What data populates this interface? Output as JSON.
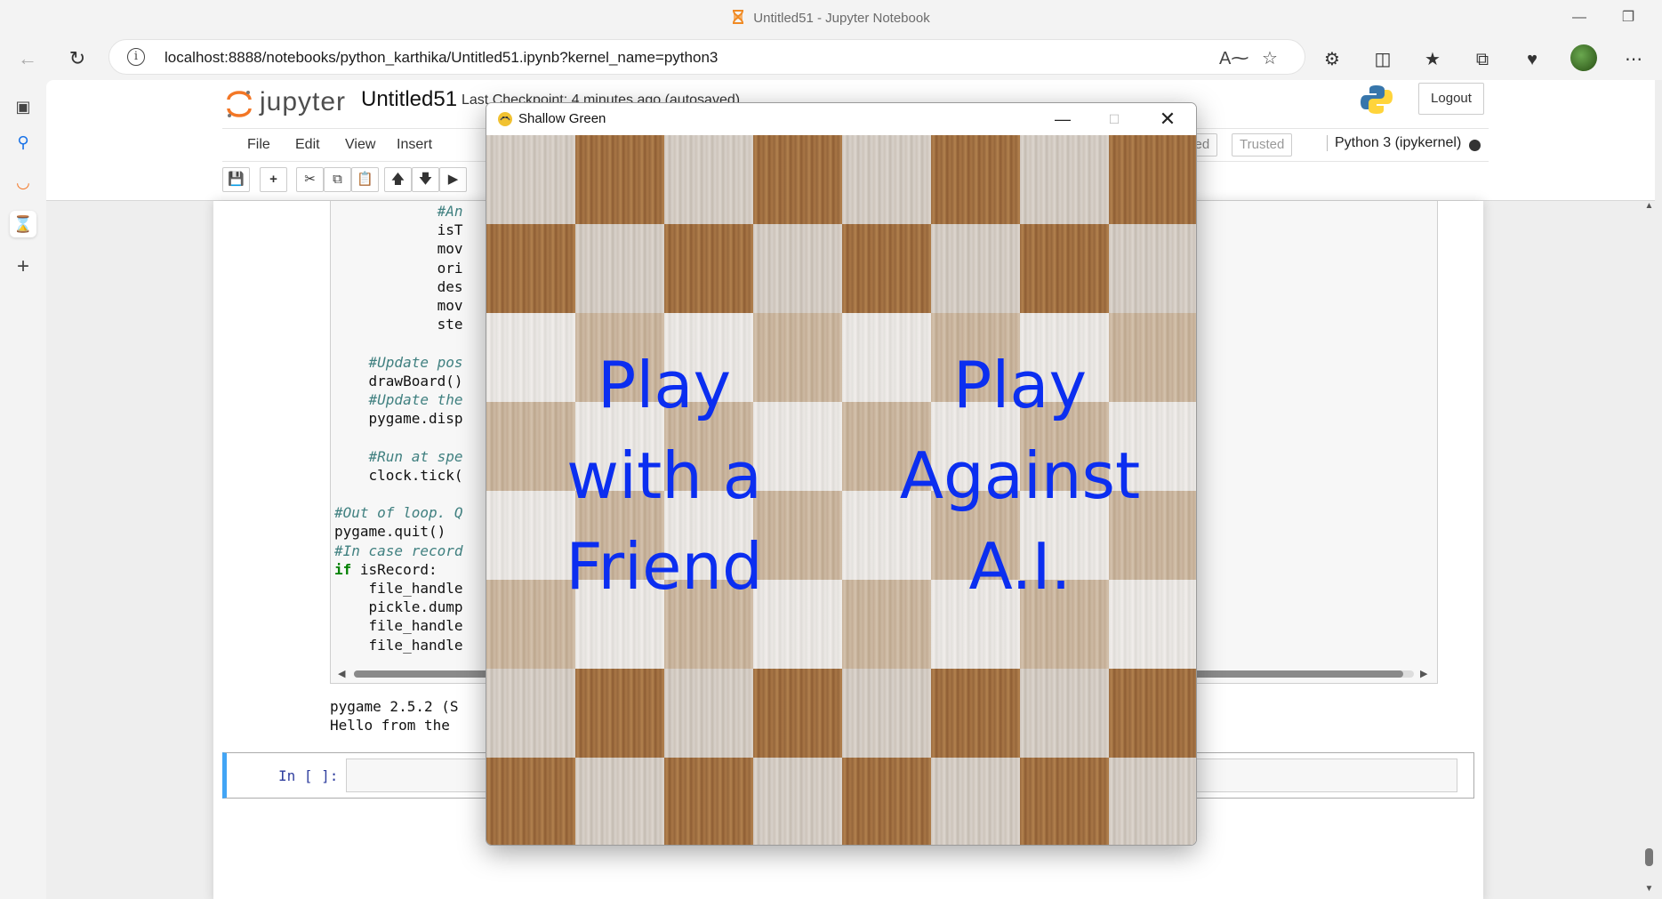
{
  "browser": {
    "window_title": "Untitled51 - Jupyter Notebook",
    "url": "localhost:8888/notebooks/python_karthika/Untitled51.ipynb?kernel_name=python3"
  },
  "jupyter": {
    "logo_text": "jupyter",
    "notebook_name": "Untitled51",
    "checkpoint": "Last Checkpoint: 4 minutes ago  (autosaved)",
    "logout": "Logout",
    "menu": [
      "File",
      "Edit",
      "View",
      "Insert"
    ],
    "saved_flag": "ved",
    "trusted": "Trusted",
    "kernel": "Python 3 (ipykernel)"
  },
  "code": {
    "lines": [
      {
        "text": "            #An",
        "comment": true
      },
      {
        "text": "            isT",
        "comment": false
      },
      {
        "text": "            mov",
        "comment": false
      },
      {
        "text": "            ori",
        "comment": false
      },
      {
        "text": "            des",
        "comment": false
      },
      {
        "text": "            mov",
        "comment": false
      },
      {
        "text": "            ste",
        "comment": false
      },
      {
        "text": "",
        "comment": false
      },
      {
        "text": "    #Update pos",
        "comment": true
      },
      {
        "text": "    drawBoard()",
        "comment": false
      },
      {
        "text": "    #Update the",
        "comment": true
      },
      {
        "text": "    pygame.disp",
        "comment": false
      },
      {
        "text": "",
        "comment": false
      },
      {
        "text": "    #Run at spe",
        "comment": true
      },
      {
        "text": "    clock.tick(",
        "comment": false
      },
      {
        "text": "",
        "comment": false
      },
      {
        "text": "#Out of loop. Q",
        "comment": true
      },
      {
        "text": "pygame.quit()",
        "comment": false
      },
      {
        "text": "#In case record",
        "comment": true
      },
      {
        "text": "if isRecord:",
        "comment": false,
        "keyword": "if"
      },
      {
        "text": "    file_handle",
        "comment": false
      },
      {
        "text": "    pickle.dump",
        "comment": false
      },
      {
        "text": "    file_handle",
        "comment": false
      },
      {
        "text": "    file_handle",
        "comment": false
      }
    ],
    "output": [
      "pygame 2.5.2 (S",
      "Hello from the "
    ],
    "prompt": "In [ ]:"
  },
  "pygame_window": {
    "title": "Shallow Green",
    "option_friend": [
      "Play",
      "with a",
      "Friend"
    ],
    "option_ai": [
      "Play",
      "Against",
      "A.I."
    ],
    "text_color": "#0b2ef0"
  }
}
